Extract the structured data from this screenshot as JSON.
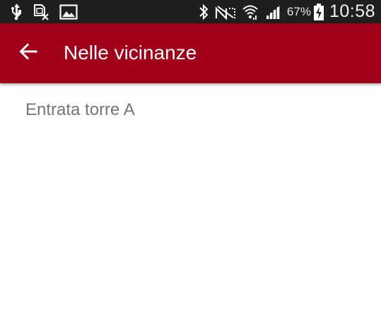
{
  "status_bar": {
    "icons_left": [
      "usb-icon",
      "sim-off-icon",
      "image-icon"
    ],
    "icons_right": [
      "bluetooth-icon",
      "nfc-icon",
      "wifi-icon",
      "signal-icon",
      "battery-charging-icon"
    ],
    "battery_percent": "67%",
    "time": "10:58"
  },
  "app_bar": {
    "title": "Nelle vicinanze",
    "background_color": "#a00018",
    "back_icon": "arrow-back-icon"
  },
  "list": {
    "items": [
      {
        "label": "Entrata torre A"
      }
    ]
  }
}
